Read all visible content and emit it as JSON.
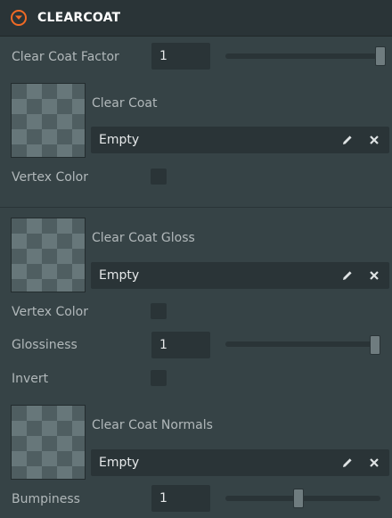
{
  "header": {
    "title": "CLEARCOAT",
    "toggle_icon": "chevron-down-circle-icon",
    "accent": "#f06a25"
  },
  "clear_coat_factor": {
    "label": "Clear Coat Factor",
    "value": "1",
    "slider_fraction": 1.0
  },
  "clear_coat_map": {
    "name": "Clear Coat",
    "value": "Empty",
    "edit_icon": "pencil-icon",
    "clear_icon": "close-icon"
  },
  "clear_coat_vertex": {
    "label": "Vertex Color",
    "checked": false
  },
  "gloss_map": {
    "name": "Clear Coat Gloss",
    "value": "Empty",
    "edit_icon": "pencil-icon",
    "clear_icon": "close-icon"
  },
  "gloss_vertex": {
    "label": "Vertex Color",
    "checked": false
  },
  "glossiness": {
    "label": "Glossiness",
    "value": "1",
    "slider_fraction": 1.0
  },
  "invert": {
    "label": "Invert",
    "checked": false
  },
  "normals_map": {
    "name": "Clear Coat Normals",
    "value": "Empty",
    "edit_icon": "pencil-icon",
    "clear_icon": "close-icon"
  },
  "bumpiness": {
    "label": "Bumpiness",
    "value": "1",
    "slider_fraction": 0.47
  },
  "colors": {
    "panel_bg": "#364346",
    "field_bg": "#2a3437",
    "text": "#b1b8ba",
    "value_text": "#e6e9ea"
  }
}
